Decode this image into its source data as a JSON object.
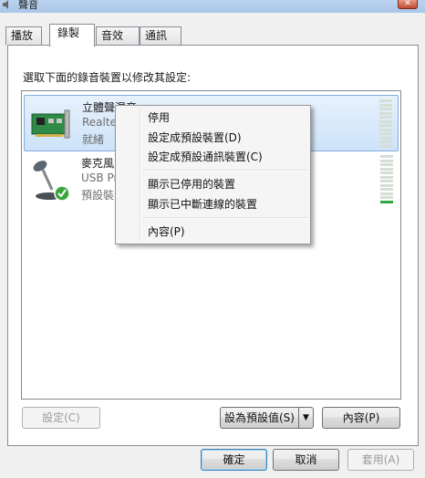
{
  "window": {
    "title": "聲音",
    "close_label": "✕"
  },
  "tabs": [
    {
      "label": "播放"
    },
    {
      "label": "錄製"
    },
    {
      "label": "音效"
    },
    {
      "label": "通訊"
    }
  ],
  "instruction": "選取下面的錄音裝置以修改其設定:",
  "devices": [
    {
      "name": "立體聲混音",
      "sub": "Realte",
      "status": "就緒",
      "icon": "sound-card-icon",
      "level_segments_on": 0
    },
    {
      "name": "麥克風",
      "sub": "USB Pr",
      "status": "預設裝",
      "icon": "microphone-icon",
      "level_segments_on": 1
    }
  ],
  "context_menu": {
    "items": [
      {
        "label": "停用"
      },
      {
        "label": "設定成預設裝置(D)"
      },
      {
        "label": "設定成預設通訊裝置(C)"
      },
      {
        "label": "顯示已停用的裝置"
      },
      {
        "label": "顯示已中斷連線的裝置"
      },
      {
        "label": "內容(P)"
      }
    ]
  },
  "panel_buttons": {
    "configure": "設定(C)",
    "set_default": "設為預設值(S)",
    "properties": "內容(P)"
  },
  "dialog_buttons": {
    "ok": "確定",
    "cancel": "取消",
    "apply": "套用(A)"
  },
  "colors": {
    "selection_bg": "#cde3f9",
    "selection_border": "#84acdd",
    "level_on": "#2ea83f",
    "check_green": "#3aa53a"
  }
}
